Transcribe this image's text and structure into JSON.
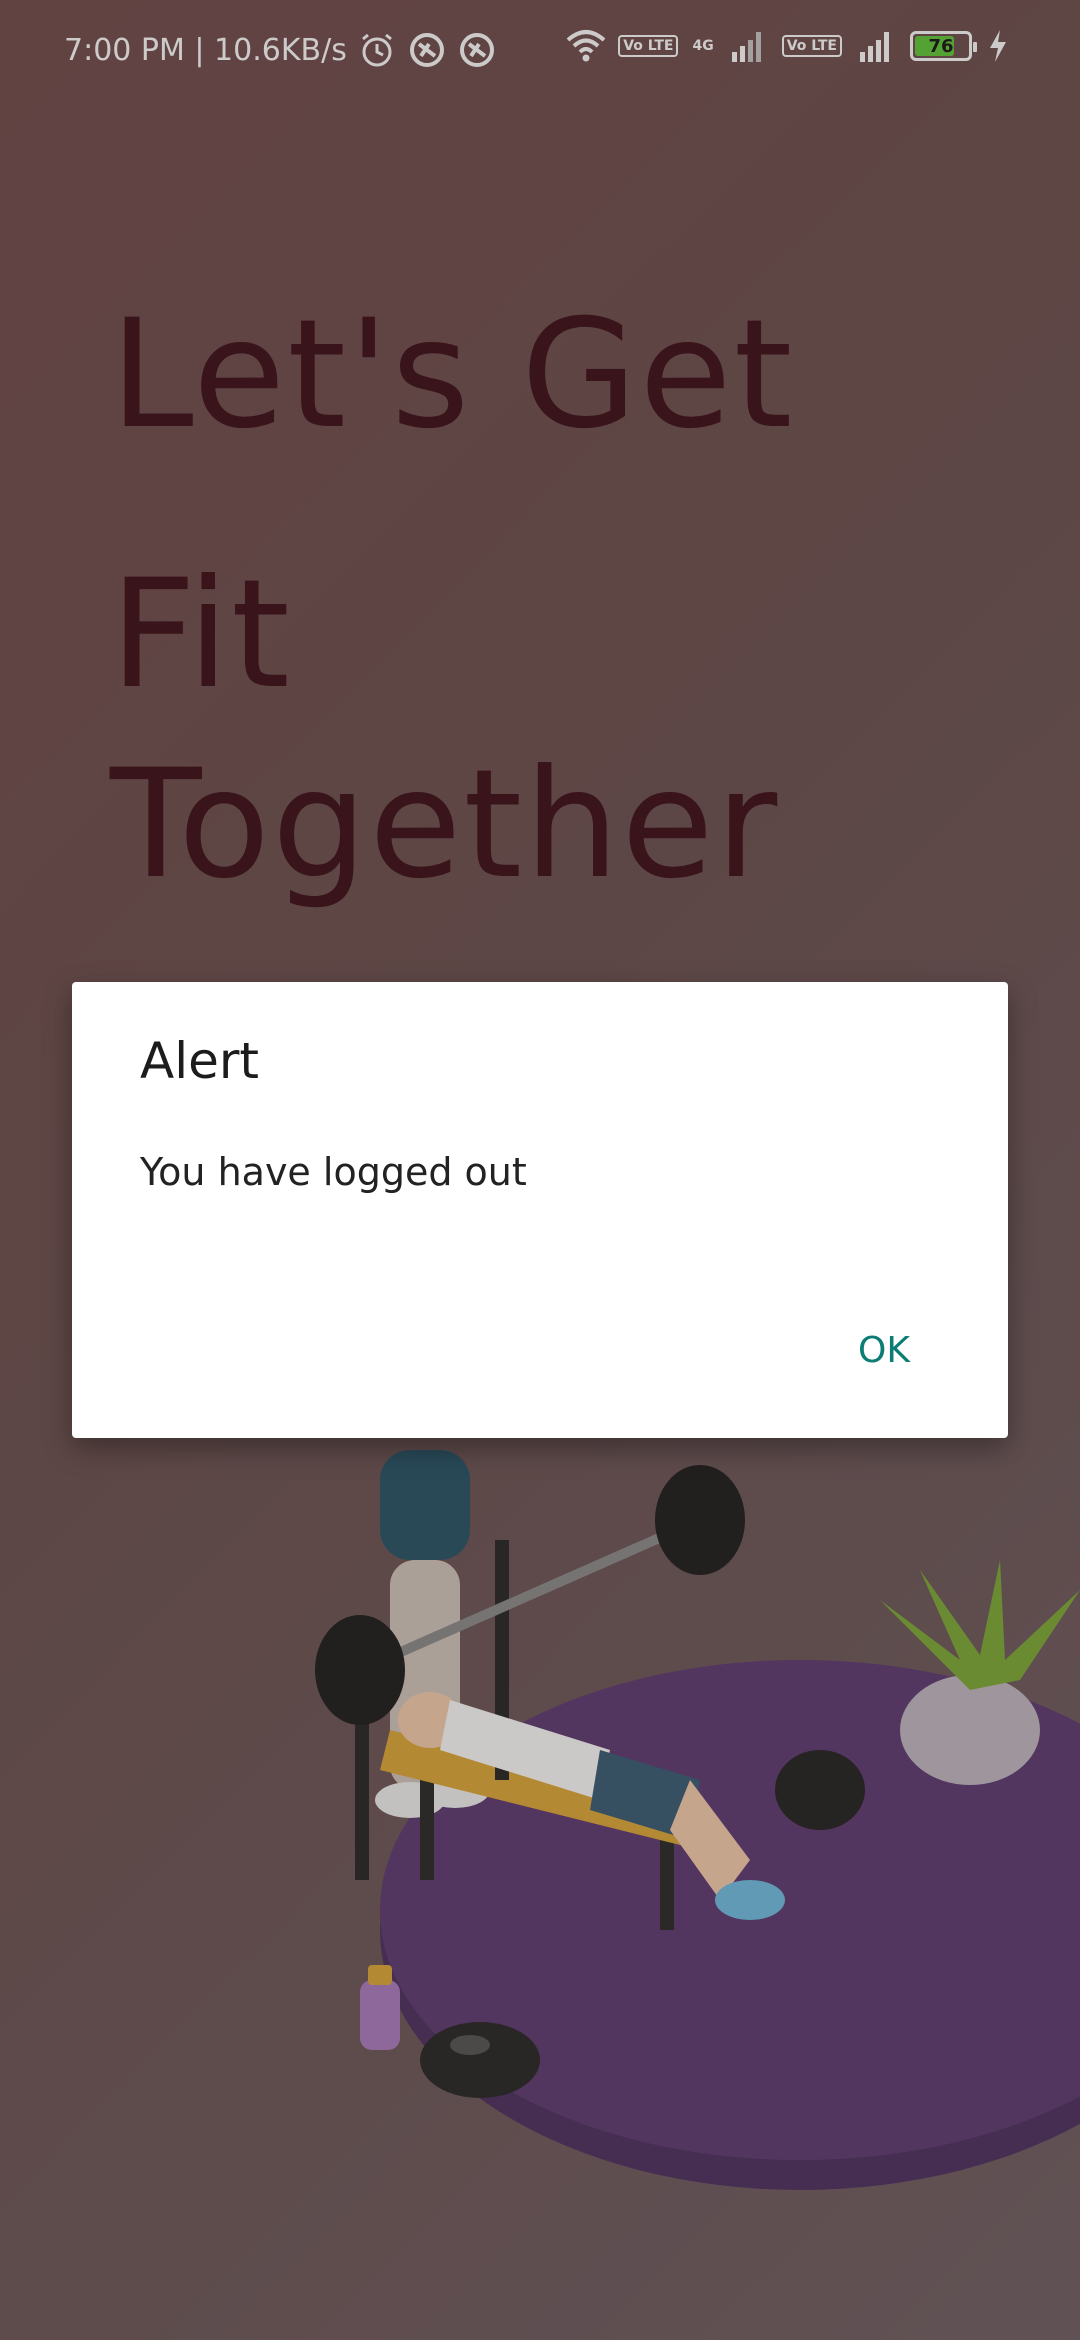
{
  "status_bar": {
    "time_and_speed": "7:00 PM | 10.6KB/s",
    "lte_label_1": "Vo LTE",
    "net_label": "4G",
    "lte_label_2": "Vo LTE",
    "battery_level": "76",
    "icons": [
      "alarm-icon",
      "app-icon",
      "app-icon",
      "wifi-icon",
      "signal-icon",
      "signal-icon",
      "battery-icon",
      "charging-icon"
    ]
  },
  "headline": {
    "line1": "Let's Get",
    "line2": "Fit",
    "line3": "Together"
  },
  "dialog": {
    "title": "Alert",
    "message": "You have logged out",
    "ok_label": "OK"
  },
  "colors": {
    "headline": "#3d141c",
    "accent_button": "#0b7d74",
    "platform": "#5d3e6f"
  }
}
